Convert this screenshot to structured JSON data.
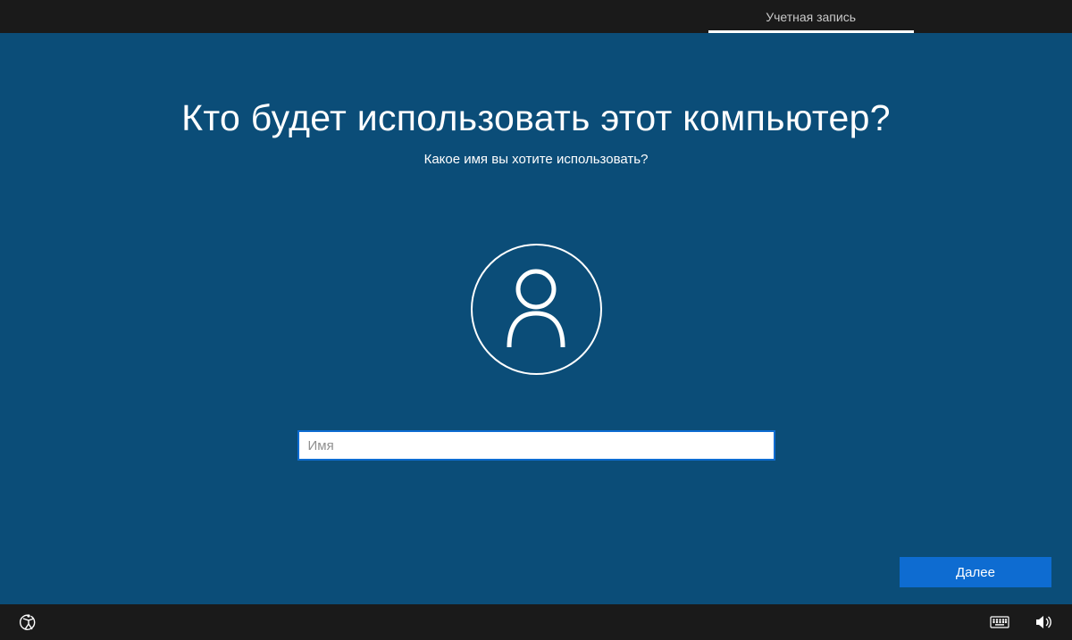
{
  "topbar": {
    "tab_label": "Учетная запись"
  },
  "main": {
    "heading": "Кто будет использовать этот компьютер?",
    "subheading": "Какое имя вы хотите использовать?",
    "name_placeholder": "Имя",
    "name_value": "",
    "next_label": "Далее"
  },
  "icons": {
    "avatar": "user-icon",
    "ease_of_access": "accessibility-icon",
    "keyboard": "keyboard-icon",
    "volume": "volume-icon"
  }
}
